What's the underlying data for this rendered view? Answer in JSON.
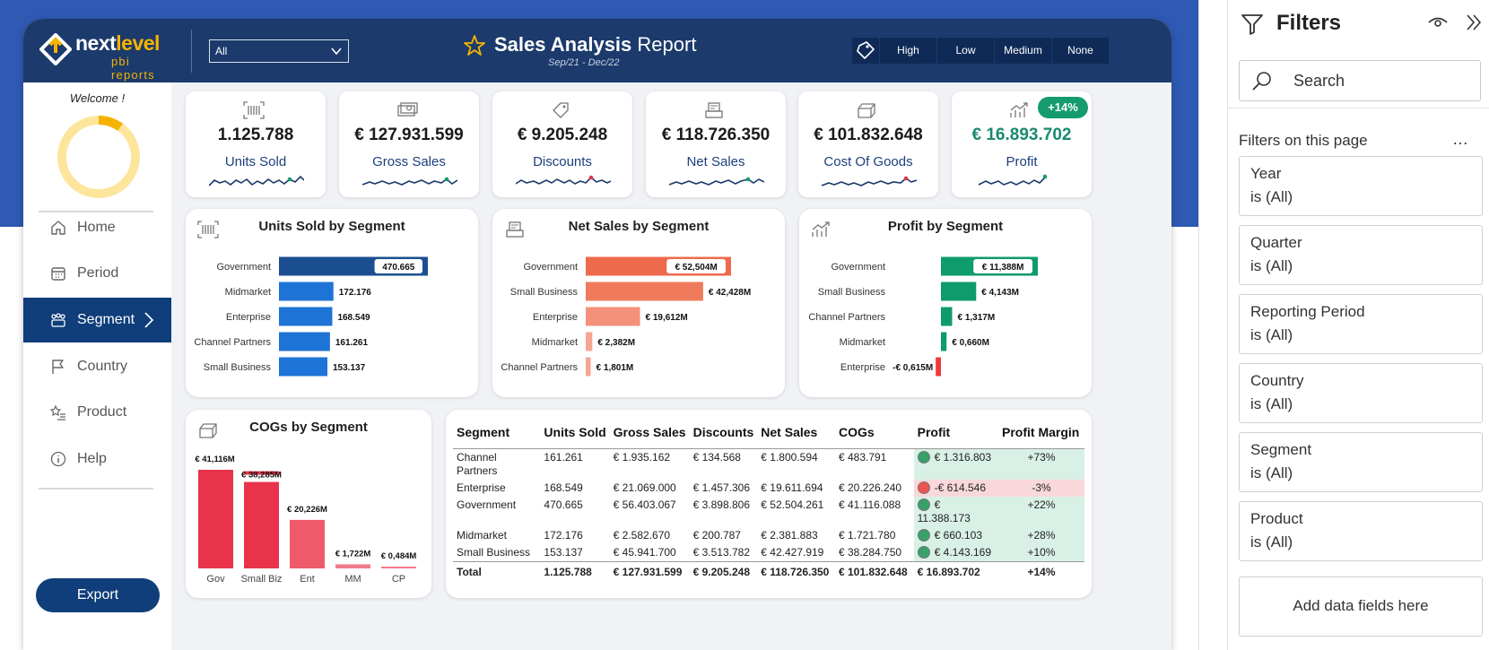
{
  "header": {
    "logo_main": "next",
    "logo_accent": "level",
    "logo_sub": "pbi reports",
    "dropdown_value": "All",
    "title_bold": "Sales Analysis",
    "title_rest": "Report",
    "subtitle": "Sep/21 - Dec/22",
    "priority_options": [
      "High",
      "Low",
      "Medium",
      "None"
    ]
  },
  "nav": {
    "welcome": "Welcome !",
    "progress_fraction": 0.1,
    "items": [
      {
        "label": "Home",
        "icon": "home-icon"
      },
      {
        "label": "Period",
        "icon": "calendar-icon"
      },
      {
        "label": "Segment",
        "icon": "people-icon",
        "active": true
      },
      {
        "label": "Country",
        "icon": "flag-icon"
      },
      {
        "label": "Product",
        "icon": "star-list-icon"
      },
      {
        "label": "Help",
        "icon": "info-icon"
      }
    ],
    "export_label": "Export"
  },
  "kpis": [
    {
      "value": "1.125.788",
      "label": "Units Sold",
      "icon": "barcode-icon"
    },
    {
      "value": "€ 127.931.599",
      "label": "Gross Sales",
      "icon": "cash-icon"
    },
    {
      "value": "€ 9.205.248",
      "label": "Discounts",
      "icon": "tag-icon"
    },
    {
      "value": "€ 118.726.350",
      "label": "Net Sales",
      "icon": "register-icon"
    },
    {
      "value": "€ 101.832.648",
      "label": "Cost Of Goods",
      "icon": "box-icon"
    },
    {
      "value": "€ 16.893.702",
      "label": "Profit",
      "icon": "trend-icon",
      "badge": "+14%"
    }
  ],
  "chart_data": [
    {
      "type": "bar",
      "orientation": "horizontal",
      "title": "Units Sold by Segment",
      "categories": [
        "Government",
        "Midmarket",
        "Enterprise",
        "Channel Partners",
        "Small Business"
      ],
      "values": [
        470665,
        172176,
        168549,
        161261,
        153137
      ],
      "data_labels": [
        "470.665",
        "172.176",
        "168.549",
        "161.261",
        "153.137"
      ],
      "colors": [
        "#1b4f91",
        "#1e74d6",
        "#1e74d6",
        "#1e74d6",
        "#1e74d6"
      ]
    },
    {
      "type": "bar",
      "orientation": "horizontal",
      "title": "Net Sales by Segment",
      "categories": [
        "Government",
        "Small Business",
        "Enterprise",
        "Midmarket",
        "Channel Partners"
      ],
      "values": [
        52.504,
        42.428,
        19.612,
        2.382,
        1.801
      ],
      "data_labels": [
        "€ 52,504M",
        "€ 42,428M",
        "€ 19,612M",
        "€ 2,382M",
        "€ 1,801M"
      ],
      "colors": [
        "#ee6a4d",
        "#ef7b5c",
        "#f3917a",
        "#f5a592",
        "#f5a592"
      ]
    },
    {
      "type": "bar",
      "orientation": "horizontal",
      "title": "Profit by Segment",
      "categories": [
        "Government",
        "Small Business",
        "Channel Partners",
        "Midmarket",
        "Enterprise"
      ],
      "values": [
        11.388,
        4.143,
        1.317,
        0.66,
        -0.615
      ],
      "data_labels": [
        "€ 11,388M",
        "€ 4,143M",
        "€ 1,317M",
        "€ 0,660M",
        "-€ 0,615M"
      ],
      "colors": [
        "#0f9b6c",
        "#0f9b6c",
        "#0f9b6c",
        "#0f9b6c",
        "#ef3b3b"
      ]
    },
    {
      "type": "bar",
      "orientation": "vertical",
      "title": "COGs by Segment",
      "categories": [
        "Gov",
        "Small Biz",
        "Ent",
        "MM",
        "CP"
      ],
      "values": [
        41.116,
        38.285,
        20.226,
        1.722,
        0.484
      ],
      "data_labels": [
        "€ 41,116M",
        "€ 38,285M",
        "€ 20,226M",
        "€ 1,722M",
        "€ 0,484M"
      ],
      "colors": [
        "#e8334a",
        "#e8334a",
        "#ee5a6a",
        "#f07c88",
        "#f07c88"
      ]
    }
  ],
  "table": {
    "headers": [
      "Segment",
      "Units Sold",
      "Gross Sales",
      "Discounts",
      "Net Sales",
      "COGs",
      "Profit",
      "Profit Margin"
    ],
    "rows": [
      {
        "segment": "Channel Partners",
        "units": "161.261",
        "gross": "€ 1.935.162",
        "disc": "€ 134.568",
        "net": "€ 1.800.594",
        "cogs": "€ 483.791",
        "profit": "€ 1.316.803",
        "margin": "+73%",
        "status": "positive"
      },
      {
        "segment": "Enterprise",
        "units": "168.549",
        "gross": "€ 21.069.000",
        "disc": "€ 1.457.306",
        "net": "€ 19.611.694",
        "cogs": "€ 20.226.240",
        "profit": "-€ 614.546",
        "margin": "-3%",
        "status": "negative"
      },
      {
        "segment": "Government",
        "units": "470.665",
        "gross": "€ 56.403.067",
        "disc": "€ 3.898.806",
        "net": "€ 52.504.261",
        "cogs": "€ 41.116.088",
        "profit": "€ 11.388.173",
        "margin": "+22%",
        "status": "positive"
      },
      {
        "segment": "Midmarket",
        "units": "172.176",
        "gross": "€ 2.582.670",
        "disc": "€ 200.787",
        "net": "€ 2.381.883",
        "cogs": "€ 1.721.780",
        "profit": "€ 660.103",
        "margin": "+28%",
        "status": "positive"
      },
      {
        "segment": "Small Business",
        "units": "153.137",
        "gross": "€ 45.941.700",
        "disc": "€ 3.513.782",
        "net": "€ 42.427.919",
        "cogs": "€ 38.284.750",
        "profit": "€ 4.143.169",
        "margin": "+10%",
        "status": "positive"
      }
    ],
    "total": {
      "segment": "Total",
      "units": "1.125.788",
      "gross": "€ 127.931.599",
      "disc": "€ 9.205.248",
      "net": "€ 118.726.350",
      "cogs": "€ 101.832.648",
      "profit": "€ 16.893.702",
      "margin": "+14%"
    }
  },
  "filters": {
    "title": "Filters",
    "search_placeholder": "Search",
    "section": "Filters on this page",
    "more": "…",
    "cards": [
      {
        "name": "Year",
        "state": "is (All)"
      },
      {
        "name": "Quarter",
        "state": "is (All)"
      },
      {
        "name": "Reporting Period",
        "state": "is (All)"
      },
      {
        "name": "Country",
        "state": "is (All)"
      },
      {
        "name": "Segment",
        "state": "is (All)"
      },
      {
        "name": "Product",
        "state": "is (All)"
      }
    ],
    "add_fields": "Add data fields here"
  },
  "colors": {
    "header": "#1c3a6b",
    "accent": "#f5b301",
    "nav_active": "#0f3e7a",
    "profit": "#1a8a6e"
  }
}
